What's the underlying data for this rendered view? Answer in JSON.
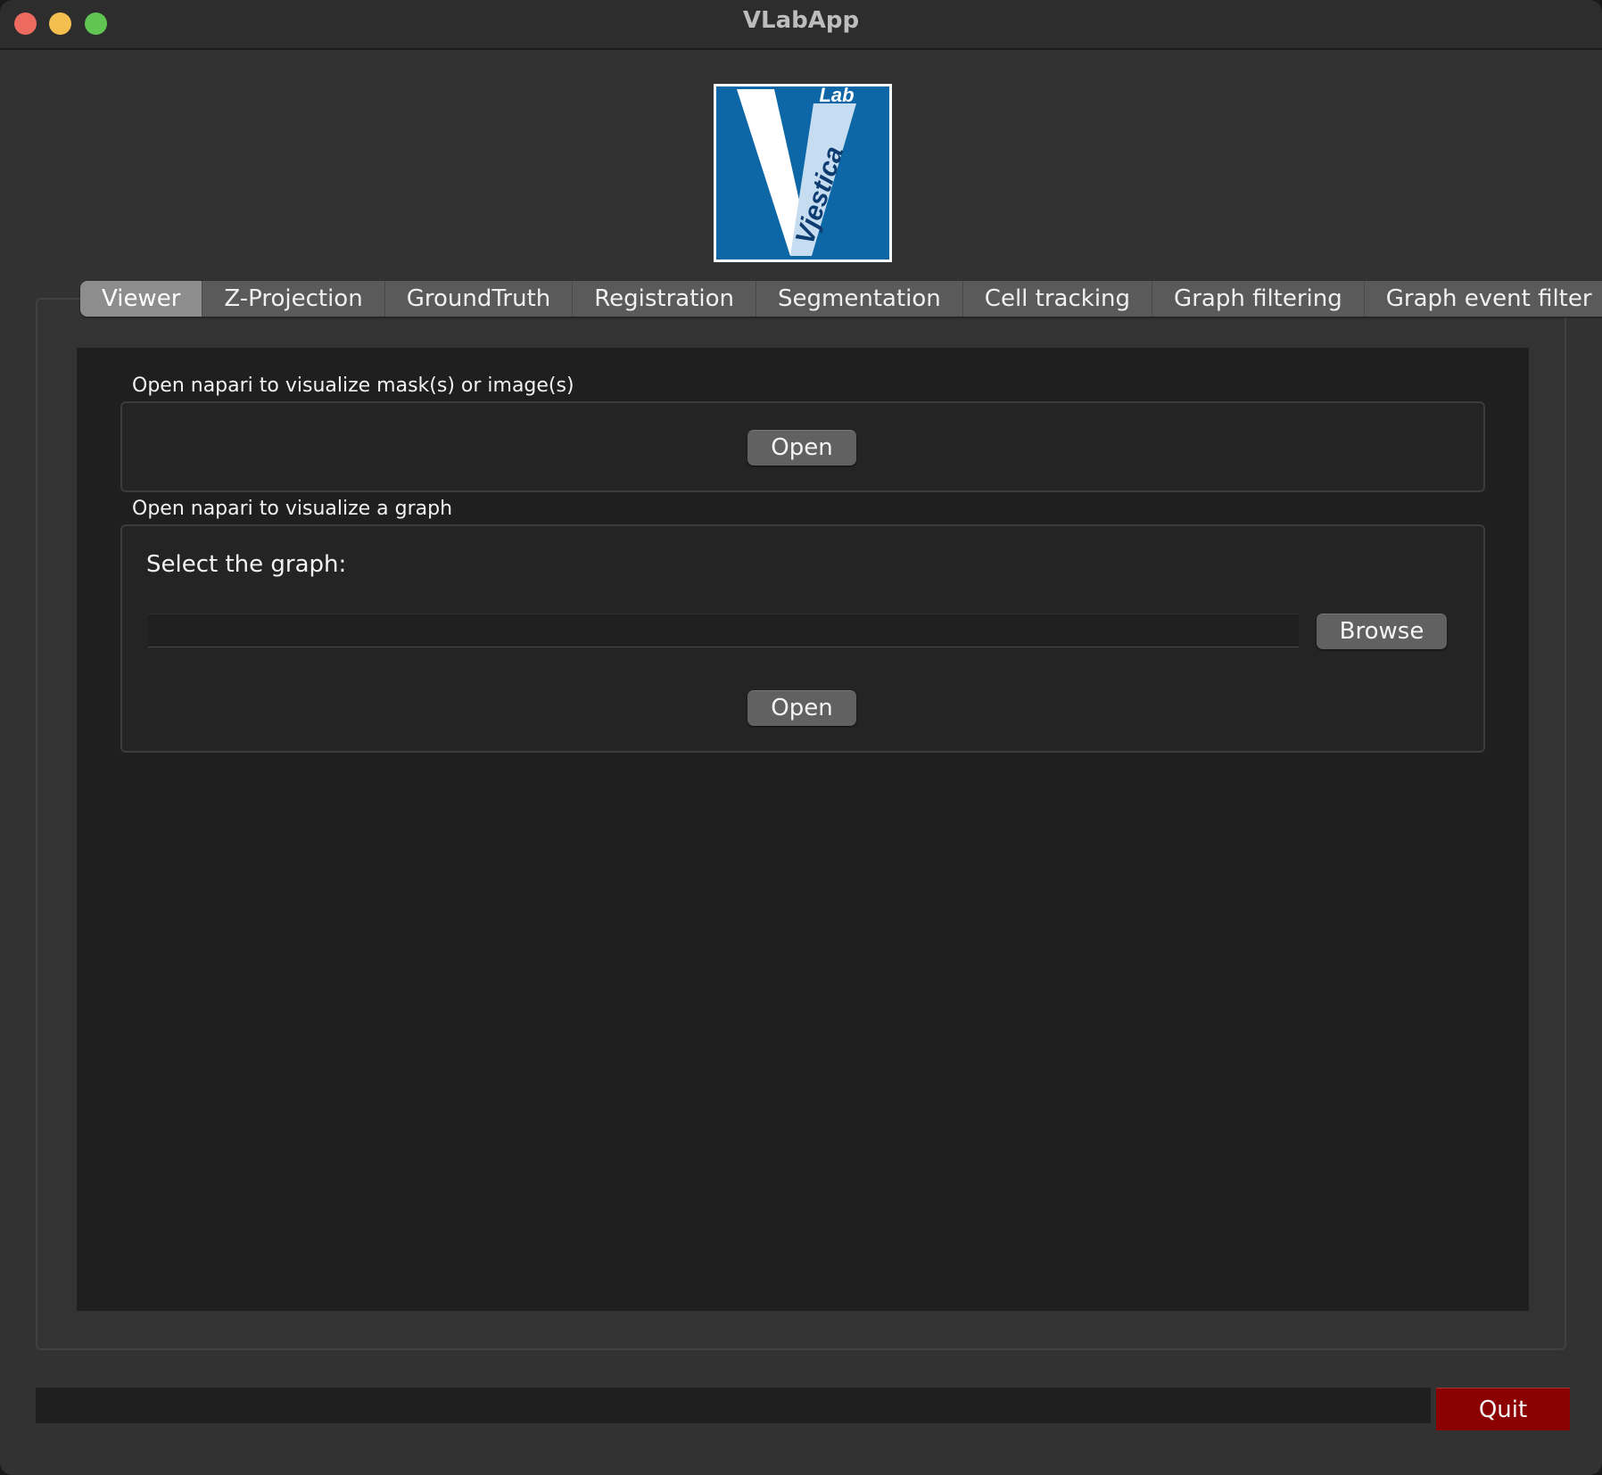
{
  "window": {
    "title": "VLabApp"
  },
  "logo": {
    "text_lab": "Lab",
    "text_name": "Vjestica",
    "colors": {
      "blue": "#0d67a6",
      "light": "#c6ddf1",
      "white": "#ffffff"
    }
  },
  "tabs": [
    {
      "label": "Viewer",
      "active": true
    },
    {
      "label": "Z-Projection",
      "active": false
    },
    {
      "label": "GroundTruth",
      "active": false
    },
    {
      "label": "Registration",
      "active": false
    },
    {
      "label": "Segmentation",
      "active": false
    },
    {
      "label": "Cell tracking",
      "active": false
    },
    {
      "label": "Graph filtering",
      "active": false
    },
    {
      "label": "Graph event filter",
      "active": false
    }
  ],
  "viewer": {
    "images_group": {
      "title": "Open napari to visualize mask(s) or image(s)",
      "open_label": "Open"
    },
    "graph_group": {
      "title": "Open napari to visualize a graph",
      "select_label": "Select the graph:",
      "path_value": "",
      "browse_label": "Browse",
      "open_label": "Open"
    }
  },
  "footer": {
    "status_text": "",
    "quit_label": "Quit",
    "quit_color": "#8b0000"
  }
}
